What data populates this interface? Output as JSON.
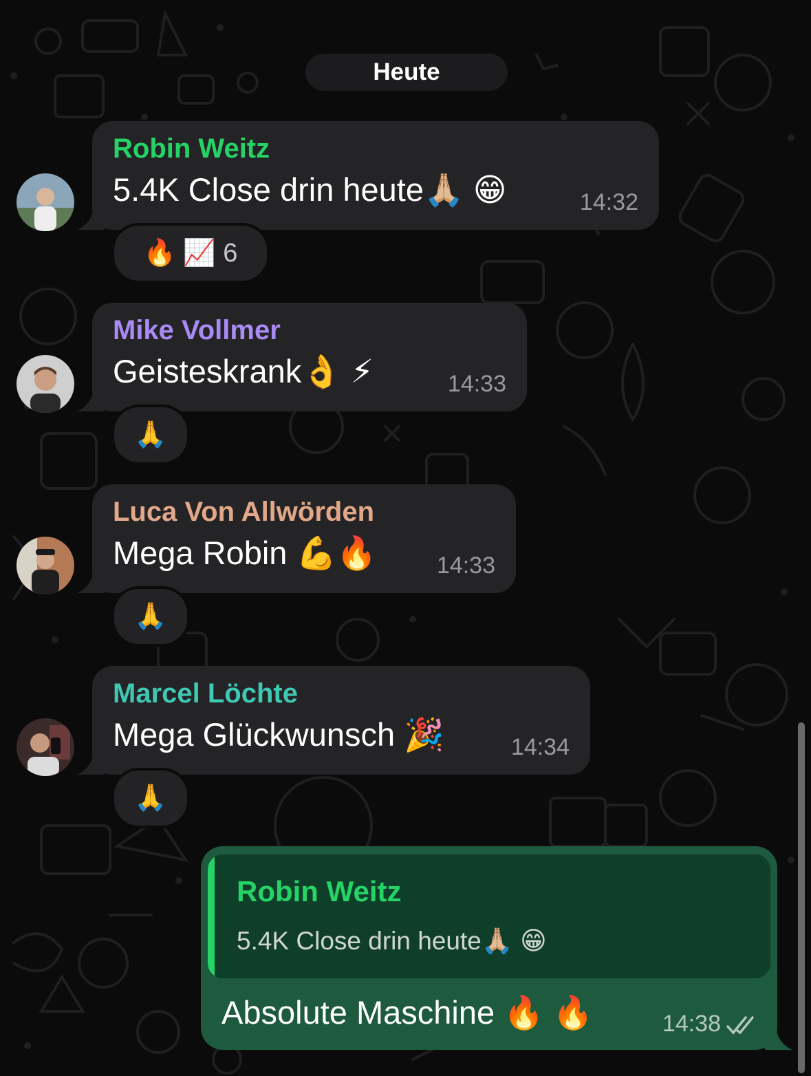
{
  "date_separator": "Heute",
  "messages": [
    {
      "sender": "Robin Weitz",
      "sender_color": "#25d366",
      "text": "5.4K Close drin heute🙏🏼 😁",
      "time": "14:32",
      "reactions": "🔥 📈 6"
    },
    {
      "sender": "Mike Vollmer",
      "sender_color": "#a88bf5",
      "text": "Geisteskrank👌 ⚡",
      "time": "14:33",
      "reactions": "🙏"
    },
    {
      "sender": "Luca Von Allwörden",
      "sender_color": "#e2a889",
      "text": "Mega Robin 💪🔥",
      "time": "14:33",
      "reactions": "🙏"
    },
    {
      "sender": "Marcel Löchte",
      "sender_color": "#3fc8b4",
      "text": "Mega Glückwunsch 🎉",
      "time": "14:34",
      "reactions": "🙏"
    }
  ],
  "outgoing": {
    "quote_sender": "Robin Weitz",
    "quote_text": "5.4K Close drin heute🙏🏼 😁",
    "text": "Absolute Maschine 🔥 🔥",
    "time": "14:38",
    "status_icon": "double-check-icon"
  },
  "colors": {
    "incoming_bubble": "#242426",
    "outgoing_bubble": "#1d5a3e",
    "background": "#0b0b0b"
  }
}
